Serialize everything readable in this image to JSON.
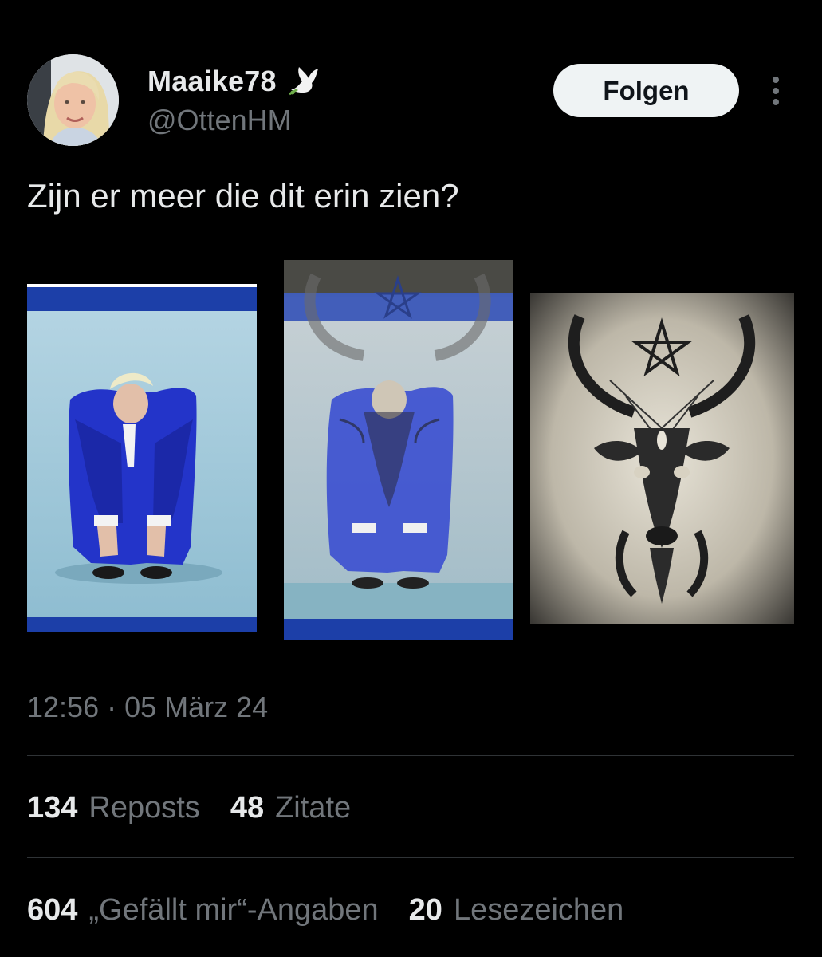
{
  "author": {
    "display_name": "Maaike78",
    "handle": "@OttenHM",
    "badge_icon": "dove-icon"
  },
  "follow_button": {
    "label": "Folgen"
  },
  "tweet": {
    "text": "Zijn er meer die dit erin zien?",
    "timestamp": "12:56 · 05 März 24"
  },
  "media": [
    {
      "description_name": "singer-photo-blue-suit"
    },
    {
      "description_name": "overlay-photo-goat-flag"
    },
    {
      "description_name": "goat-head-pentagram-drawing"
    }
  ],
  "stats_row_1": [
    {
      "count": "134",
      "label": "Reposts"
    },
    {
      "count": "48",
      "label": "Zitate"
    }
  ],
  "stats_row_2": [
    {
      "count": "604",
      "label": "„Gefällt mir“-Angaben"
    },
    {
      "count": "20",
      "label": "Lesezeichen"
    }
  ],
  "colors": {
    "background": "#000000",
    "text_primary": "#e7e9ea",
    "text_secondary": "#71767b",
    "divider": "#2f3336",
    "flag_blue": "#1c3fa8"
  }
}
